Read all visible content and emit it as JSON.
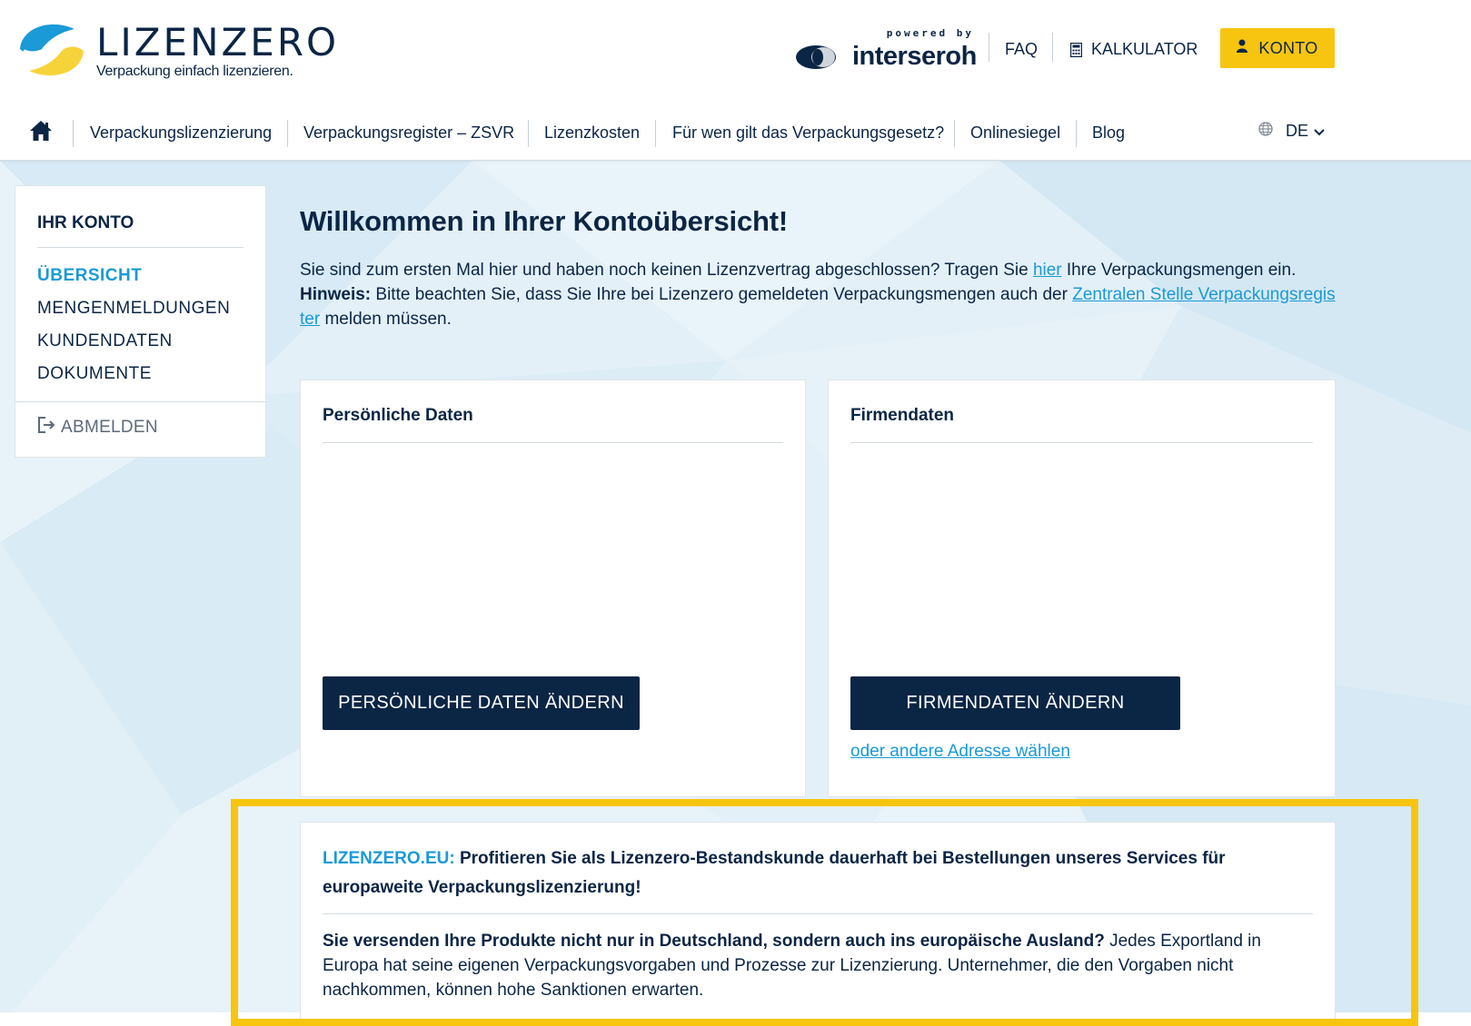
{
  "header": {
    "logo": {
      "brand": "LIZENZERO",
      "tagline": "Verpackung einfach lizenzieren."
    },
    "powered_by": {
      "label": "powered by",
      "name": "interseroh"
    },
    "links": {
      "faq": "FAQ",
      "calculator": "KALKULATOR",
      "account": "KONTO"
    }
  },
  "nav": {
    "items": [
      "Verpackungslizenzierung",
      "Verpackungsregister – ZSVR",
      "Lizenzkosten",
      "Für wen gilt das Verpackungsgesetz?",
      "Onlinesiegel",
      "Blog"
    ],
    "language": "DE"
  },
  "sidebar": {
    "title": "IHR KONTO",
    "items": [
      "ÜBERSICHT",
      "MENGENMELDUNGEN",
      "KUNDENDATEN",
      "DOKUMENTE"
    ],
    "active_index": 0,
    "logout": "ABMELDEN"
  },
  "main": {
    "title": "Willkommen in Ihrer Kontoübersicht!",
    "intro": {
      "line1_before": "Sie sind zum ersten Mal hier und haben noch keinen Lizenzvertrag abgeschlossen? Tragen Sie ",
      "line1_link": "hier",
      "line1_after": " Ihre Verpackungsmengen ein.",
      "hint_label": "Hinweis:",
      "hint_before": " Bitte beachten Sie, dass Sie Ihre bei Lizenzero gemeldeten Verpackungsmengen auch der ",
      "hint_link": "Zentralen Stelle Verpackungsregister",
      "hint_after": " melden müssen."
    },
    "cards": {
      "personal": {
        "title": "Persönliche Daten",
        "button": "PERSÖNLICHE DATEN ÄNDERN"
      },
      "company": {
        "title": "Firmendaten",
        "button": "FIRMENDATEN ÄNDERN",
        "link": "oder andere Adresse wählen"
      }
    },
    "promo": {
      "brand": "LIZENZERO.EU:",
      "headline": " Profitieren Sie als Lizenzero-Bestandskunde dauerhaft bei Bestellungen unseres Services für europaweite Verpackungslizenzierung!",
      "body_bold": "Sie versenden Ihre Produkte nicht nur in Deutschland, sondern auch ins europäische Ausland?",
      "body_rest": " Jedes Exportland in Europa hat seine eigenen Verpackungsvorgaben und Prozesse zur Lizenzierung. Unternehmer, die den Vorgaben nicht nachkommen, können hohe Sanktionen erwarten."
    }
  },
  "colors": {
    "navy": "#0b2545",
    "accent_blue": "#1a9ad6",
    "accent_yellow": "#f7c510",
    "bg_light": "#e3f0f8"
  },
  "icons": {
    "home": "home-icon",
    "calculator": "calculator-icon",
    "account": "user-icon",
    "globe": "globe-icon",
    "chevron": "chevron-down-icon",
    "logout": "logout-icon"
  }
}
